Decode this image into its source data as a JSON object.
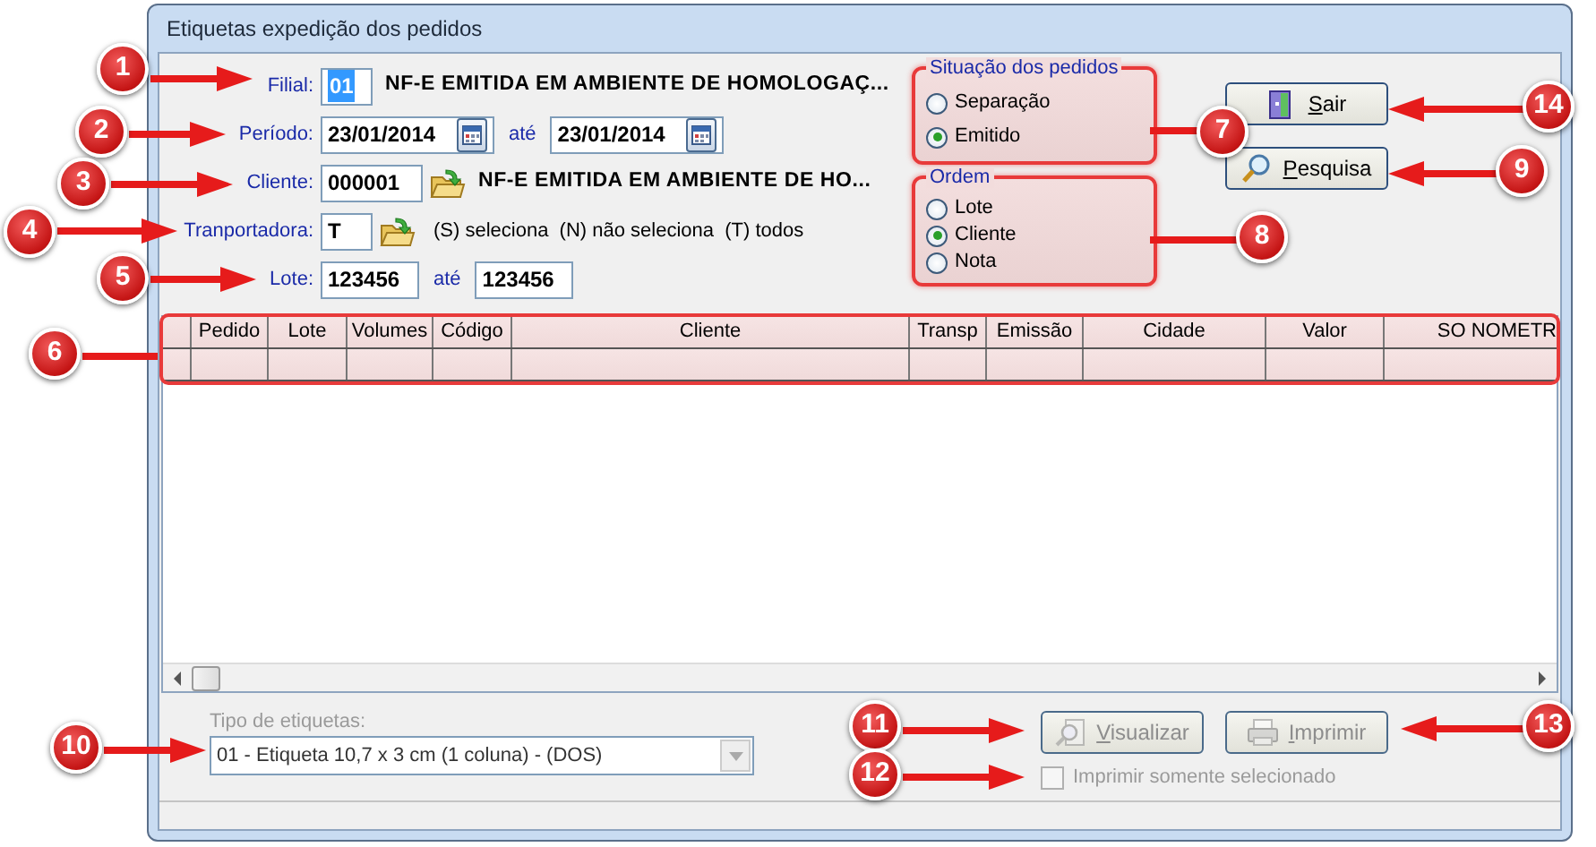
{
  "window": {
    "title": "Etiquetas expedição dos pedidos"
  },
  "form": {
    "filial": {
      "label": "Filial:",
      "value": "01",
      "description": "NF-E EMITIDA EM AMBIENTE DE HOMOLOGAÇ..."
    },
    "periodo": {
      "label": "Período:",
      "from": "23/01/2014",
      "to_label": "até",
      "to": "23/01/2014"
    },
    "cliente": {
      "label": "Cliente:",
      "value": "000001",
      "description": "NF-E EMITIDA EM AMBIENTE DE HO..."
    },
    "transportadora": {
      "label": "Tranportadora:",
      "value": "T",
      "hint": "(S) seleciona  (N) não seleciona  (T) todos"
    },
    "lote": {
      "label": "Lote:",
      "from": "123456",
      "to_label": "até",
      "to": "123456"
    }
  },
  "status_group": {
    "title": "Situação dos pedidos",
    "highlighted": true,
    "options": [
      {
        "label": "Separação",
        "selected": false
      },
      {
        "label": "Emitido",
        "selected": true
      }
    ]
  },
  "order_group": {
    "title": "Ordem",
    "highlighted": true,
    "options": [
      {
        "label": "Lote",
        "selected": false
      },
      {
        "label": "Cliente",
        "selected": true
      },
      {
        "label": "Nota",
        "selected": false
      }
    ]
  },
  "buttons": [
    {
      "label": "Sair",
      "disabled": false
    },
    {
      "label": "Pesquisa",
      "disabled": false
    }
  ],
  "grid": {
    "highlighted": true,
    "columns": [
      "Pedido",
      "Lote",
      "Volumes",
      "Código",
      "Cliente",
      "Transp",
      "Emissão",
      "Cidade",
      "Valor",
      "SO NOMETR"
    ]
  },
  "label_type": {
    "label": "Tipo de etiquetas:",
    "value": "01 - Etiqueta 10,7 x 3 cm (1 coluna) - (DOS)",
    "disabled": true
  },
  "actions": [
    {
      "label": "Visualizar",
      "disabled": true
    },
    {
      "label": "Imprimir",
      "disabled": true
    }
  ],
  "only_selected": {
    "label": "Imprimir somente selecionado",
    "checked": false,
    "disabled": true
  },
  "callouts": [
    {
      "number": "1"
    },
    {
      "number": "2"
    },
    {
      "number": "3"
    },
    {
      "number": "4"
    },
    {
      "number": "5"
    },
    {
      "number": "6"
    },
    {
      "number": "7"
    },
    {
      "number": "8"
    },
    {
      "number": "9"
    },
    {
      "number": "10"
    },
    {
      "number": "11"
    },
    {
      "number": "12"
    },
    {
      "number": "13"
    },
    {
      "number": "14"
    }
  ]
}
